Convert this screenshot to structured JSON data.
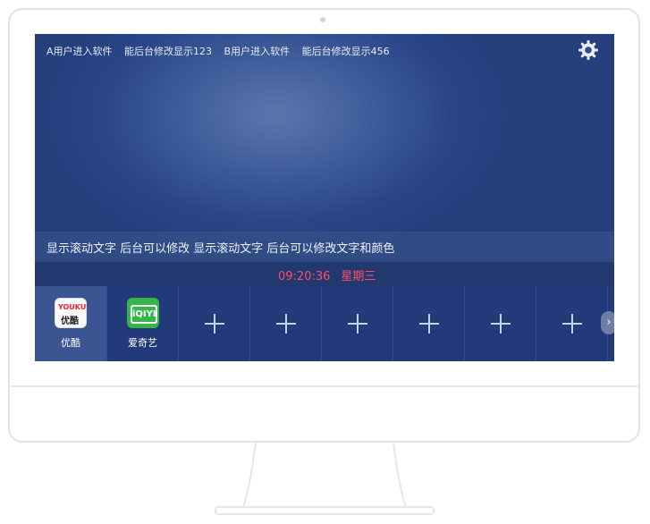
{
  "screen": {
    "top_info": [
      "A用户进入软件",
      "能后台修改显示123",
      "B用户进入软件",
      "能后台修改显示456"
    ],
    "marquee": "显示滚动文字  后台可以修改  显示滚动文字   后台可以修改文字和颜色",
    "clock": {
      "time": "09:20:36",
      "weekday": "星期三",
      "color": "#ff4e62"
    },
    "apps": [
      {
        "label": "优酷",
        "icon": "youku-icon",
        "icon_text_top": "YOUKU",
        "icon_text_bottom": "优酷"
      },
      {
        "label": "爱奇艺",
        "icon": "iqiyi-icon",
        "icon_text": "iQIYI"
      }
    ],
    "empty_slots": 6
  }
}
